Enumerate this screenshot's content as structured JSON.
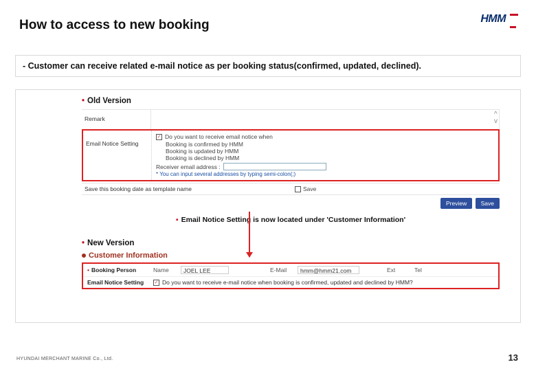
{
  "brand": "HMM",
  "title": "How to access to new booking",
  "subtitle": "- Customer can receive related e-mail notice as per booking status(confirmed, updated, declined).",
  "old": {
    "header": "Old Version",
    "remark_label": "Remark",
    "email_label": "Email Notice Setting",
    "chk_main": "Do you want to receive email notice when",
    "line1": "Booking is confirmed by HMM",
    "line2": "Booking is updated by HMM",
    "line3": "Booking is declined by HMM",
    "rx_label": "Receiver email address :",
    "hint": "* You can input several addresses by typing semi-colon(;)",
    "save_label": "Save this booking date as template name",
    "save_chk": "Save",
    "preview_btn": "Preview",
    "save_btn": "Save"
  },
  "note": "Email Notice Setting  is now located under 'Customer Information'",
  "new": {
    "header": "New Version",
    "cust_info": "Customer Information",
    "bp_label": "Booking Person",
    "name_sub": "Name",
    "name_val": "JOEL  LEE",
    "email_sub": "E-Mail",
    "email_val": "hmm@hmm21.com",
    "ext_sub": "Ext",
    "tel_sub": "Tel",
    "ens_label": "Email Notice Setting",
    "ens_text": "Do you want to receive e-mail notice when booking is confirmed, updated and declined by HMM?"
  },
  "footer": "HYUNDAI MERCHANT MARINE Co., Ltd.",
  "page": "13"
}
